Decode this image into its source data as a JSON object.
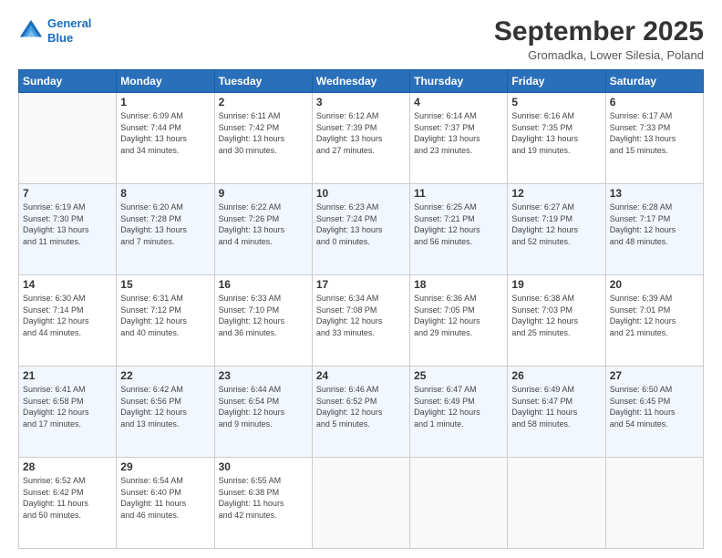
{
  "logo": {
    "line1": "General",
    "line2": "Blue"
  },
  "title": "September 2025",
  "subtitle": "Gromadka, Lower Silesia, Poland",
  "days_header": [
    "Sunday",
    "Monday",
    "Tuesday",
    "Wednesday",
    "Thursday",
    "Friday",
    "Saturday"
  ],
  "weeks": [
    [
      {
        "day": "",
        "info": ""
      },
      {
        "day": "1",
        "info": "Sunrise: 6:09 AM\nSunset: 7:44 PM\nDaylight: 13 hours\nand 34 minutes."
      },
      {
        "day": "2",
        "info": "Sunrise: 6:11 AM\nSunset: 7:42 PM\nDaylight: 13 hours\nand 30 minutes."
      },
      {
        "day": "3",
        "info": "Sunrise: 6:12 AM\nSunset: 7:39 PM\nDaylight: 13 hours\nand 27 minutes."
      },
      {
        "day": "4",
        "info": "Sunrise: 6:14 AM\nSunset: 7:37 PM\nDaylight: 13 hours\nand 23 minutes."
      },
      {
        "day": "5",
        "info": "Sunrise: 6:16 AM\nSunset: 7:35 PM\nDaylight: 13 hours\nand 19 minutes."
      },
      {
        "day": "6",
        "info": "Sunrise: 6:17 AM\nSunset: 7:33 PM\nDaylight: 13 hours\nand 15 minutes."
      }
    ],
    [
      {
        "day": "7",
        "info": "Sunrise: 6:19 AM\nSunset: 7:30 PM\nDaylight: 13 hours\nand 11 minutes."
      },
      {
        "day": "8",
        "info": "Sunrise: 6:20 AM\nSunset: 7:28 PM\nDaylight: 13 hours\nand 7 minutes."
      },
      {
        "day": "9",
        "info": "Sunrise: 6:22 AM\nSunset: 7:26 PM\nDaylight: 13 hours\nand 4 minutes."
      },
      {
        "day": "10",
        "info": "Sunrise: 6:23 AM\nSunset: 7:24 PM\nDaylight: 13 hours\nand 0 minutes."
      },
      {
        "day": "11",
        "info": "Sunrise: 6:25 AM\nSunset: 7:21 PM\nDaylight: 12 hours\nand 56 minutes."
      },
      {
        "day": "12",
        "info": "Sunrise: 6:27 AM\nSunset: 7:19 PM\nDaylight: 12 hours\nand 52 minutes."
      },
      {
        "day": "13",
        "info": "Sunrise: 6:28 AM\nSunset: 7:17 PM\nDaylight: 12 hours\nand 48 minutes."
      }
    ],
    [
      {
        "day": "14",
        "info": "Sunrise: 6:30 AM\nSunset: 7:14 PM\nDaylight: 12 hours\nand 44 minutes."
      },
      {
        "day": "15",
        "info": "Sunrise: 6:31 AM\nSunset: 7:12 PM\nDaylight: 12 hours\nand 40 minutes."
      },
      {
        "day": "16",
        "info": "Sunrise: 6:33 AM\nSunset: 7:10 PM\nDaylight: 12 hours\nand 36 minutes."
      },
      {
        "day": "17",
        "info": "Sunrise: 6:34 AM\nSunset: 7:08 PM\nDaylight: 12 hours\nand 33 minutes."
      },
      {
        "day": "18",
        "info": "Sunrise: 6:36 AM\nSunset: 7:05 PM\nDaylight: 12 hours\nand 29 minutes."
      },
      {
        "day": "19",
        "info": "Sunrise: 6:38 AM\nSunset: 7:03 PM\nDaylight: 12 hours\nand 25 minutes."
      },
      {
        "day": "20",
        "info": "Sunrise: 6:39 AM\nSunset: 7:01 PM\nDaylight: 12 hours\nand 21 minutes."
      }
    ],
    [
      {
        "day": "21",
        "info": "Sunrise: 6:41 AM\nSunset: 6:58 PM\nDaylight: 12 hours\nand 17 minutes."
      },
      {
        "day": "22",
        "info": "Sunrise: 6:42 AM\nSunset: 6:56 PM\nDaylight: 12 hours\nand 13 minutes."
      },
      {
        "day": "23",
        "info": "Sunrise: 6:44 AM\nSunset: 6:54 PM\nDaylight: 12 hours\nand 9 minutes."
      },
      {
        "day": "24",
        "info": "Sunrise: 6:46 AM\nSunset: 6:52 PM\nDaylight: 12 hours\nand 5 minutes."
      },
      {
        "day": "25",
        "info": "Sunrise: 6:47 AM\nSunset: 6:49 PM\nDaylight: 12 hours\nand 1 minute."
      },
      {
        "day": "26",
        "info": "Sunrise: 6:49 AM\nSunset: 6:47 PM\nDaylight: 11 hours\nand 58 minutes."
      },
      {
        "day": "27",
        "info": "Sunrise: 6:50 AM\nSunset: 6:45 PM\nDaylight: 11 hours\nand 54 minutes."
      }
    ],
    [
      {
        "day": "28",
        "info": "Sunrise: 6:52 AM\nSunset: 6:42 PM\nDaylight: 11 hours\nand 50 minutes."
      },
      {
        "day": "29",
        "info": "Sunrise: 6:54 AM\nSunset: 6:40 PM\nDaylight: 11 hours\nand 46 minutes."
      },
      {
        "day": "30",
        "info": "Sunrise: 6:55 AM\nSunset: 6:38 PM\nDaylight: 11 hours\nand 42 minutes."
      },
      {
        "day": "",
        "info": ""
      },
      {
        "day": "",
        "info": ""
      },
      {
        "day": "",
        "info": ""
      },
      {
        "day": "",
        "info": ""
      }
    ]
  ]
}
